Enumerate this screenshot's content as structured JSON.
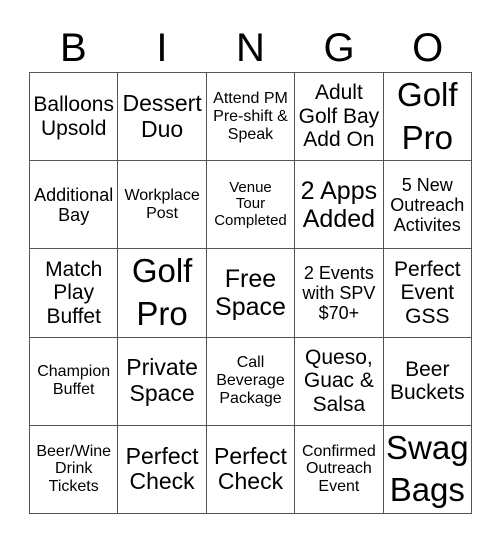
{
  "header": {
    "letters": [
      "B",
      "I",
      "N",
      "G",
      "O"
    ]
  },
  "cells": [
    "Balloons\nUpsold",
    "Dessert\nDuo",
    "Attend PM\nPre-shift &\nSpeak",
    "Adult\nGolf Bay\nAdd On",
    "Golf\nPro",
    "Additional\nBay",
    "Workplace\nPost",
    "Venue\nTour\nCompleted",
    "2 Apps\nAdded",
    "5 New\nOutreach\nActivites",
    "Match\nPlay\nBuffet",
    "Golf\nPro",
    "Free\nSpace",
    "2 Events\nwith SPV\n$70+",
    "Perfect\nEvent\nGSS",
    "Champion\nBuffet",
    "Private\nSpace",
    "Call\nBeverage\nPackage",
    "Queso,\nGuac &\nSalsa",
    "Beer\nBuckets",
    "Beer/Wine\nDrink\nTickets",
    "Perfect\nCheck",
    "Perfect\nCheck",
    "Confirmed\nOutreach\nEvent",
    "Swag\nBags"
  ]
}
